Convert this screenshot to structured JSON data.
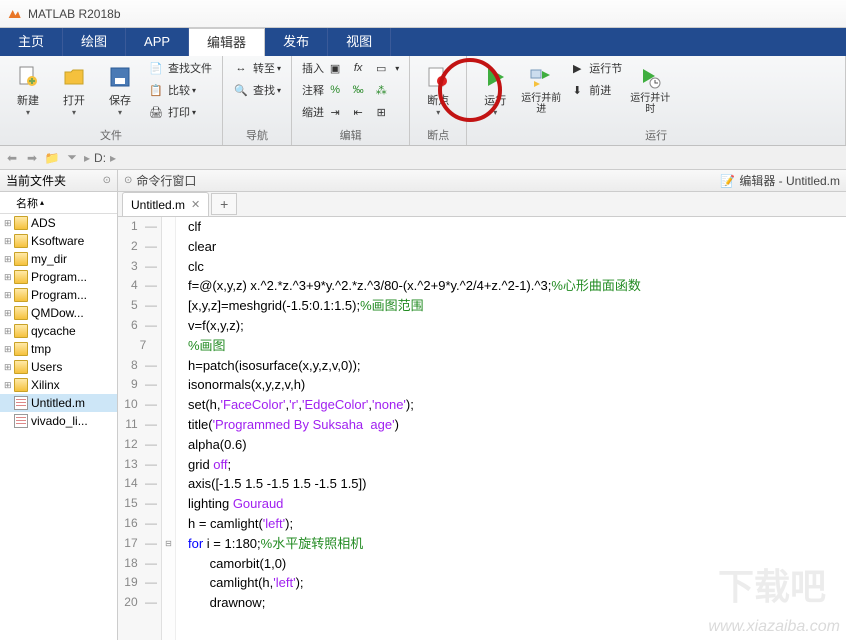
{
  "title": "MATLAB R2018b",
  "tabs": [
    "主页",
    "绘图",
    "APP",
    "编辑器",
    "发布",
    "视图"
  ],
  "active_tab_index": 3,
  "ribbon": {
    "g_file": {
      "label": "文件",
      "new": "新建",
      "open": "打开",
      "save": "保存",
      "find_files": "查找文件",
      "compare": "比较",
      "print": "打印"
    },
    "g_nav": {
      "label": "导航",
      "goto": "转至",
      "find": "查找"
    },
    "g_edit": {
      "label": "编辑",
      "insert": "插入",
      "comment": "注释",
      "indent": "缩进",
      "fx": "fx"
    },
    "g_bp": {
      "label": "断点",
      "breakpoints": "断点"
    },
    "g_run": {
      "label": "运行",
      "run": "运行",
      "run_advance": "运行并前进",
      "run_section": "运行节",
      "advance": "前进",
      "run_time": "运行并计时"
    }
  },
  "addrbar": {
    "path": "D:",
    "sep": "▸"
  },
  "sidebar": {
    "header": "当前文件夹",
    "col": "名称",
    "items": [
      {
        "name": "ADS",
        "type": "folder"
      },
      {
        "name": "Ksoftware",
        "type": "folder"
      },
      {
        "name": "my_dir",
        "type": "folder"
      },
      {
        "name": "Program...",
        "type": "folder"
      },
      {
        "name": "Program...",
        "type": "folder"
      },
      {
        "name": "QMDow...",
        "type": "folder"
      },
      {
        "name": "qycache",
        "type": "folder"
      },
      {
        "name": "tmp",
        "type": "folder"
      },
      {
        "name": "Users",
        "type": "folder"
      },
      {
        "name": "Xilinx",
        "type": "folder"
      },
      {
        "name": "Untitled.m",
        "type": "mfile",
        "selected": true
      },
      {
        "name": "vivado_li...",
        "type": "file"
      }
    ]
  },
  "cmd_window": {
    "title": "命令行窗口",
    "editor_label": "编辑器 - Untitled.m"
  },
  "editor": {
    "tab": "Untitled.m",
    "lines": [
      {
        "n": 1,
        "seg": [
          {
            "t": "clf",
            "c": ""
          }
        ]
      },
      {
        "n": 2,
        "seg": [
          {
            "t": "clear",
            "c": ""
          }
        ]
      },
      {
        "n": 3,
        "seg": [
          {
            "t": "clc",
            "c": ""
          }
        ]
      },
      {
        "n": 4,
        "seg": [
          {
            "t": "f=@(x,y,z) x.^2.*z.^3+9*y.^2.*z.^3/80-(x.^2+9*y.^2/4+z.^2-1).^3;",
            "c": ""
          },
          {
            "t": "%心形曲面函数",
            "c": "cmt"
          }
        ]
      },
      {
        "n": 5,
        "seg": [
          {
            "t": "[x,y,z]=meshgrid(-1.5:0.1:1.5);",
            "c": ""
          },
          {
            "t": "%画图范围",
            "c": "cmt"
          }
        ]
      },
      {
        "n": 6,
        "seg": [
          {
            "t": "v=f(x,y,z);",
            "c": ""
          }
        ]
      },
      {
        "n": 7,
        "seg": [
          {
            "t": "%画图",
            "c": "cmt"
          }
        ]
      },
      {
        "n": 8,
        "seg": [
          {
            "t": "h=patch(isosurface(x,y,z,v,0));",
            "c": ""
          }
        ]
      },
      {
        "n": 9,
        "seg": [
          {
            "t": "isonormals(x,y,z,v,h)",
            "c": ""
          }
        ]
      },
      {
        "n": 10,
        "seg": [
          {
            "t": "set(h,",
            "c": ""
          },
          {
            "t": "'FaceColor'",
            "c": "str"
          },
          {
            "t": ",",
            "c": ""
          },
          {
            "t": "'r'",
            "c": "str"
          },
          {
            "t": ",",
            "c": ""
          },
          {
            "t": "'EdgeColor'",
            "c": "str"
          },
          {
            "t": ",",
            "c": ""
          },
          {
            "t": "'none'",
            "c": "str"
          },
          {
            "t": ");",
            "c": ""
          }
        ]
      },
      {
        "n": 11,
        "seg": [
          {
            "t": "title(",
            "c": ""
          },
          {
            "t": "'Programmed By Suksaha  age'",
            "c": "str"
          },
          {
            "t": ")",
            "c": ""
          }
        ]
      },
      {
        "n": 12,
        "seg": [
          {
            "t": "alpha(0.6)",
            "c": ""
          }
        ]
      },
      {
        "n": 13,
        "seg": [
          {
            "t": "grid ",
            "c": ""
          },
          {
            "t": "off",
            "c": "str"
          },
          {
            "t": ";",
            "c": ""
          }
        ]
      },
      {
        "n": 14,
        "seg": [
          {
            "t": "axis([-1.5 1.5 -1.5 1.5 -1.5 1.5])",
            "c": ""
          }
        ]
      },
      {
        "n": 15,
        "seg": [
          {
            "t": "lighting ",
            "c": ""
          },
          {
            "t": "Gouraud",
            "c": "str"
          }
        ]
      },
      {
        "n": 16,
        "seg": [
          {
            "t": "h = camlight(",
            "c": ""
          },
          {
            "t": "'left'",
            "c": "str"
          },
          {
            "t": ");",
            "c": ""
          }
        ]
      },
      {
        "n": 17,
        "seg": [
          {
            "t": "for ",
            "c": "kw"
          },
          {
            "t": "i = 1:180;",
            "c": ""
          },
          {
            "t": "%水平旋转照相机",
            "c": "cmt"
          }
        ]
      },
      {
        "n": 18,
        "seg": [
          {
            "t": "      camorbit(1,0)",
            "c": ""
          }
        ]
      },
      {
        "n": 19,
        "seg": [
          {
            "t": "      camlight(h,",
            "c": ""
          },
          {
            "t": "'left'",
            "c": "str"
          },
          {
            "t": ");",
            "c": ""
          }
        ]
      },
      {
        "n": 20,
        "seg": [
          {
            "t": "      drawnow;",
            "c": ""
          }
        ]
      }
    ]
  },
  "watermark": {
    "url": "www.xiazaiba.com",
    "logo": "下载吧"
  }
}
